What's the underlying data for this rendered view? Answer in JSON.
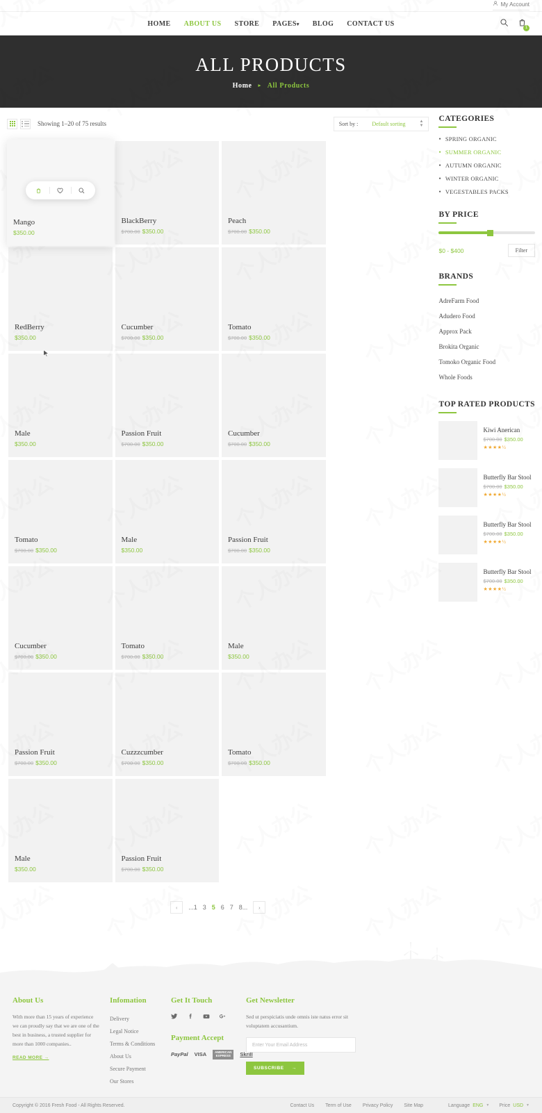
{
  "topbar": {
    "account_label": "My Account",
    "account_icon": "user-icon"
  },
  "header": {
    "nav": [
      {
        "label": "HOME",
        "active": false
      },
      {
        "label": "ABOUT US",
        "active": true
      },
      {
        "label": "STORE",
        "active": false
      },
      {
        "label": "PAGES",
        "active": false,
        "caret": "▾"
      },
      {
        "label": "BLOG",
        "active": false
      },
      {
        "label": "CONTACT US",
        "active": false
      }
    ],
    "search_icon": "search-icon",
    "cart_icon": "cart-icon",
    "cart_count": "1"
  },
  "hero": {
    "title": "ALL PRODUCTS",
    "breadcrumb_home": "Home",
    "breadcrumb_sep": "▸",
    "breadcrumb_current": "All Products"
  },
  "toolbar": {
    "showing": "Showing 1–20 of 75 results",
    "sort_label": "Sort by :",
    "sort_value": "Default sorting",
    "grid_view_icon": "grid-view-icon",
    "list_view_icon": "list-view-icon"
  },
  "products": [
    {
      "name": "Mango",
      "old": "",
      "new": "$350.00",
      "hovered": true
    },
    {
      "name": "BlackBerry",
      "old": "$700.00",
      "new": "$350.00",
      "hovered": false
    },
    {
      "name": "Peach",
      "old": "$700.00",
      "new": "$350.00",
      "hovered": false
    },
    {
      "name": "RedBerry",
      "old": "",
      "new": "$350.00",
      "hovered": false
    },
    {
      "name": "Cucumber",
      "old": "$700.00",
      "new": "$350.00",
      "hovered": false
    },
    {
      "name": "Tomato",
      "old": "$700.00",
      "new": "$350.00",
      "hovered": false
    },
    {
      "name": "Male",
      "old": "",
      "new": "$350.00",
      "hovered": false
    },
    {
      "name": "Passion Fruit",
      "old": "$700.00",
      "new": "$350.00",
      "hovered": false
    },
    {
      "name": "Cucumber",
      "old": "$700.00",
      "new": "$350.00",
      "hovered": false
    },
    {
      "name": "Tomato",
      "old": "$700.00",
      "new": "$350.00",
      "hovered": false
    },
    {
      "name": "Male",
      "old": "",
      "new": "$350.00",
      "hovered": false
    },
    {
      "name": "Passion Fruit",
      "old": "$700.00",
      "new": "$350.00",
      "hovered": false
    },
    {
      "name": "Cucumber",
      "old": "$700.00",
      "new": "$350.00",
      "hovered": false
    },
    {
      "name": "Tomato",
      "old": "$700.00",
      "new": "$350.00",
      "hovered": false
    },
    {
      "name": "Male",
      "old": "",
      "new": "$350.00",
      "hovered": false
    },
    {
      "name": "Passion Fruit",
      "old": "$700.00",
      "new": "$350.00",
      "hovered": false
    },
    {
      "name": "Cuzzzcumber",
      "old": "$700.00",
      "new": "$350.00",
      "hovered": false
    },
    {
      "name": "Tomato",
      "old": "$700.00",
      "new": "$350.00",
      "hovered": false
    },
    {
      "name": "Male",
      "old": "",
      "new": "$350.00",
      "hovered": false
    },
    {
      "name": "Passion Fruit",
      "old": "$700.00",
      "new": "$350.00",
      "hovered": false
    }
  ],
  "hover_actions": {
    "cart_icon": "add-to-cart-icon",
    "wishlist_icon": "heart-icon",
    "quickview_icon": "search-icon"
  },
  "pagination": {
    "prev": "‹",
    "next": "›",
    "items": [
      "...1",
      "3",
      "5",
      "6",
      "7",
      "8..."
    ],
    "current": "5"
  },
  "sidebar": {
    "categories": {
      "title": "CATEGORIES",
      "items": [
        {
          "label": "SPRING ORGANIC",
          "active": false
        },
        {
          "label": "SUMMER ORGANIC",
          "active": true
        },
        {
          "label": "AUTUMN ORGANIC",
          "active": false
        },
        {
          "label": "WINTER ORGANIC",
          "active": false
        },
        {
          "label": "VEGESTABLES PACKS",
          "active": false
        }
      ]
    },
    "by_price": {
      "title": "BY PRICE",
      "range": "$0 - $400",
      "filter_label": "Filter"
    },
    "brands": {
      "title": "BRANDS",
      "items": [
        "AdreFarm Food",
        "Adudero Food",
        "Approx Pack",
        "Brokita Organic",
        "Tomoko Organic Food",
        "Whole Foods"
      ]
    },
    "top_rated": {
      "title": "TOP RATED PRODUCTS",
      "items": [
        {
          "name": "Kiwi Anerican",
          "old": "$700.00",
          "new": "$350.00",
          "stars": "★★★★½"
        },
        {
          "name": "Butterfly Bar Stool",
          "old": "$700.00",
          "new": "$350.00",
          "stars": "★★★★½"
        },
        {
          "name": "Butterfly Bar Stool",
          "old": "$700.00",
          "new": "$350.00",
          "stars": "★★★★½"
        },
        {
          "name": "Butterfly Bar Stool",
          "old": "$700.00",
          "new": "$350.00",
          "stars": "★★★★½"
        }
      ]
    }
  },
  "footer": {
    "about": {
      "title": "About Us",
      "text": "With more than 15 years of experience we can proudly say that we are one of the best in business, a trusted supplier for more than 1000 companies..",
      "readmore": "READ MORE  →"
    },
    "information": {
      "title": "Infomation",
      "items": [
        "Delivery",
        "Legal Notice",
        "Terms & Conditions",
        "About Us",
        "Secure Payment",
        "Our Stores"
      ]
    },
    "touch": {
      "title": "Get It Touch",
      "socials": [
        "twitter-icon",
        "facebook-icon",
        "youtube-icon",
        "google-plus-icon"
      ],
      "payment_title": "Payment Accept",
      "payment": [
        "PayPal",
        "VISA",
        "AMERICAN EXPRESS",
        "Skrill"
      ]
    },
    "newsletter": {
      "title": "Get Newsletter",
      "text": "Sed ut perspiciatis unde omnis iste natus error sit voluptatem accusantium.",
      "placeholder": "Enter Your Email Address",
      "button": "SUBSCRIBE",
      "button_arrow": "→"
    }
  },
  "copyright": {
    "text": "Copyright © 2016 Fresh Food - All Rights Reserved.",
    "links": [
      "Contact Us",
      "Term of Use",
      "Privacy Policy",
      "Site Map"
    ],
    "language_label": "Language",
    "language_value": "ENG",
    "price_label": "Price",
    "price_value": "USD"
  },
  "theme": {
    "accent": "#8dc63f",
    "dark": "#2f2f2f",
    "muted": "#b5b5b5"
  }
}
